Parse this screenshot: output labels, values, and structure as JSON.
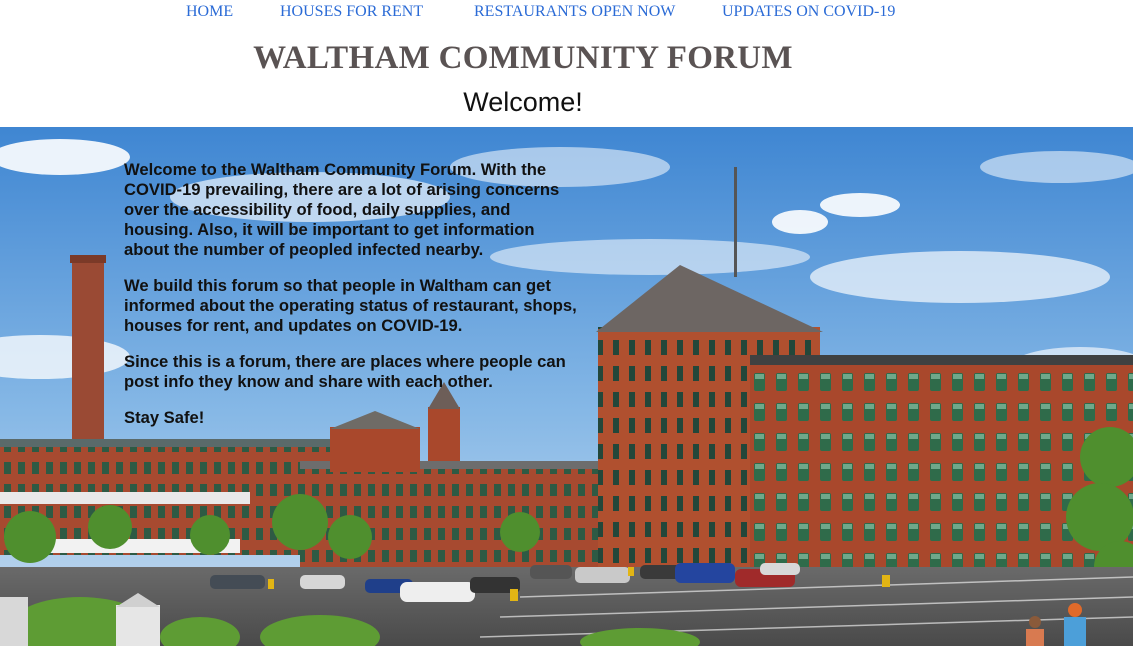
{
  "nav": {
    "items": [
      {
        "label": "HOME"
      },
      {
        "label": "HOUSES FOR RENT"
      },
      {
        "label": "RESTAURANTS OPEN NOW"
      },
      {
        "label": "UPDATES ON COVID-19"
      }
    ]
  },
  "header": {
    "title": "WALTHAM COMMUNITY FORUM",
    "welcome": "Welcome!"
  },
  "intro": {
    "paragraphs": [
      "Welcome to the Waltham Community Forum. With the COVID-19 prevailing, there are a lot of arising concerns over the accessibility of food, daily supplies, and housing. Also, it will be important to get information about the number of peopled infected nearby.",
      "We build this forum so that people in Waltham can get informed about the operating status of restaurant, shops, houses for rent, and updates on COVID-19.",
      "Since this is a forum, there are places where people can post info they know and share with each other.",
      "Stay Safe!"
    ]
  },
  "colors": {
    "nav_link": "#2b6bd6",
    "title": "#5a5353",
    "brick": "#a84a2e",
    "sky": "#5b9ad6"
  },
  "hero": {
    "subject": "photo-of-waltham-brick-mill-buildings"
  }
}
